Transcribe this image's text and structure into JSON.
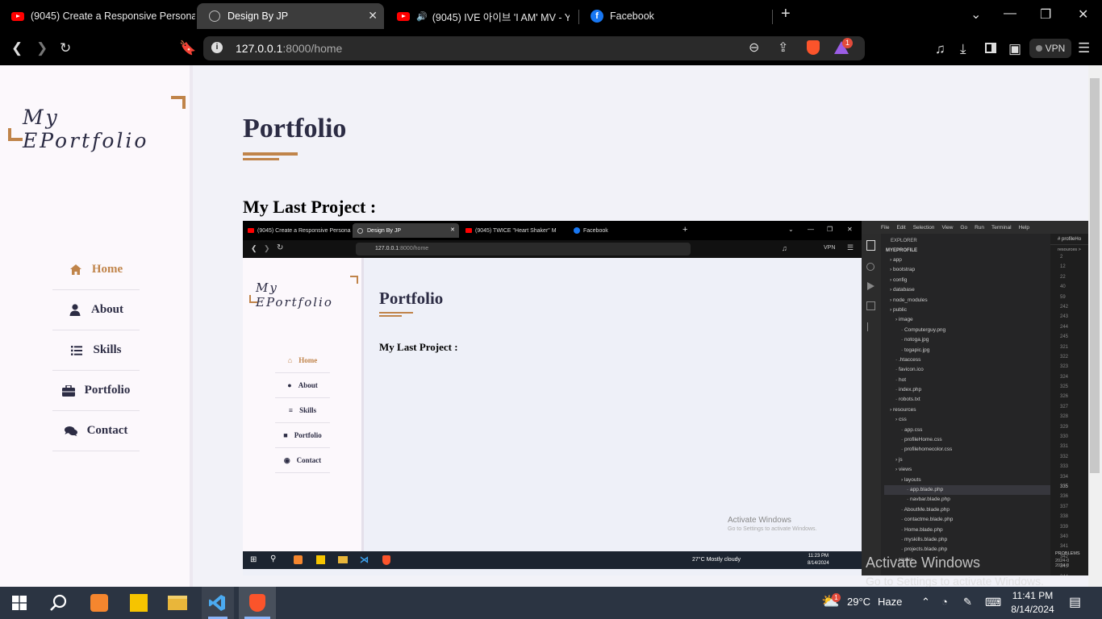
{
  "browser": {
    "tabs": [
      {
        "label": "(9045) Create a Responsive Personal",
        "icon": "youtube-icon"
      },
      {
        "label": "Design By JP",
        "icon": "globe-icon",
        "active": true
      },
      {
        "label": "(9045) IVE 아이브 'I AM' MV - Yo",
        "icon": "youtube-icon"
      },
      {
        "label": "Facebook",
        "icon": "facebook-icon"
      }
    ],
    "url_host": "127.0.0.1",
    "url_path": ":8000/home",
    "vpn_label": "VPN",
    "notification_count": "1"
  },
  "site": {
    "logo": "My EPortfolio",
    "nav": [
      {
        "label": "Home",
        "icon": "home-icon",
        "active": true
      },
      {
        "label": "About",
        "icon": "user-icon"
      },
      {
        "label": "Skills",
        "icon": "list-icon"
      },
      {
        "label": "Portfolio",
        "icon": "briefcase-icon"
      },
      {
        "label": "Contact",
        "icon": "comments-icon"
      }
    ],
    "title": "Portfolio",
    "subtitle": "My Last Project :"
  },
  "screenshot": {
    "tabs": [
      "(9045) Create a Responsive Persona",
      "Design By JP",
      "(9045) TWICE \"Heart Shaker\" M",
      "Facebook"
    ],
    "url_host": "127.0.0.1",
    "url_path": ":8000/home",
    "logo": "My EPortfolio",
    "nav": [
      "Home",
      "About",
      "Skills",
      "Portfolio",
      "Contact"
    ],
    "title": "Portfolio",
    "subtitle": "My Last Project :",
    "activate_title": "Activate Windows",
    "activate_sub": "Go to Settings to activate Windows.",
    "weather": "27°C  Mostly cloudy",
    "time": "11:23 PM",
    "date": "8/14/2024",
    "vscode_menu": [
      "File",
      "Edit",
      "Selection",
      "View",
      "Go",
      "Run",
      "Terminal",
      "Help"
    ],
    "explorer_label": "EXPLORER",
    "project": "MYEPROFILE",
    "tree": [
      "app",
      "bootstrap",
      "config",
      "database",
      "node_modules",
      "public",
      "image",
      "Computerguy.png",
      "notoga.jpg",
      "togapic.jpg",
      ".htaccess",
      "favicon.ico",
      "hot",
      "index.php",
      "robots.txt",
      "resources",
      "css",
      "app.css",
      "profileHome.css",
      "profilehomecolor.css",
      "js",
      "views",
      "layouts",
      "app.blade.php",
      "navbar.blade.php",
      "AboutMe.blade.php",
      "contactme.blade.php",
      "Home.blade.php",
      "myskills.blade.php",
      "projects.blade.php",
      "routes"
    ],
    "line_numbers": [
      "2",
      "12",
      "22",
      "40",
      "59",
      "242",
      "243",
      "244",
      "245",
      "321",
      "322",
      "323",
      "324",
      "325",
      "326",
      "327",
      "328",
      "329",
      "330",
      "331",
      "332",
      "333",
      "334",
      "335",
      "336",
      "337",
      "338",
      "339",
      "340",
      "341",
      "342",
      "343",
      "344"
    ],
    "editor_tab": "profileHo",
    "breadcrumb": "resources >",
    "problems": "PROBLEMS",
    "log1": "2024-0",
    "log2": "2024-0"
  },
  "overlay": {
    "activate_title": "Activate Windows",
    "activate_sub": "Go to Settings to activate Windows."
  },
  "taskbar": {
    "weather_temp": "29°C",
    "weather_text": "Haze",
    "weather_badge": "1",
    "time": "11:41 PM",
    "date": "8/14/2024"
  }
}
